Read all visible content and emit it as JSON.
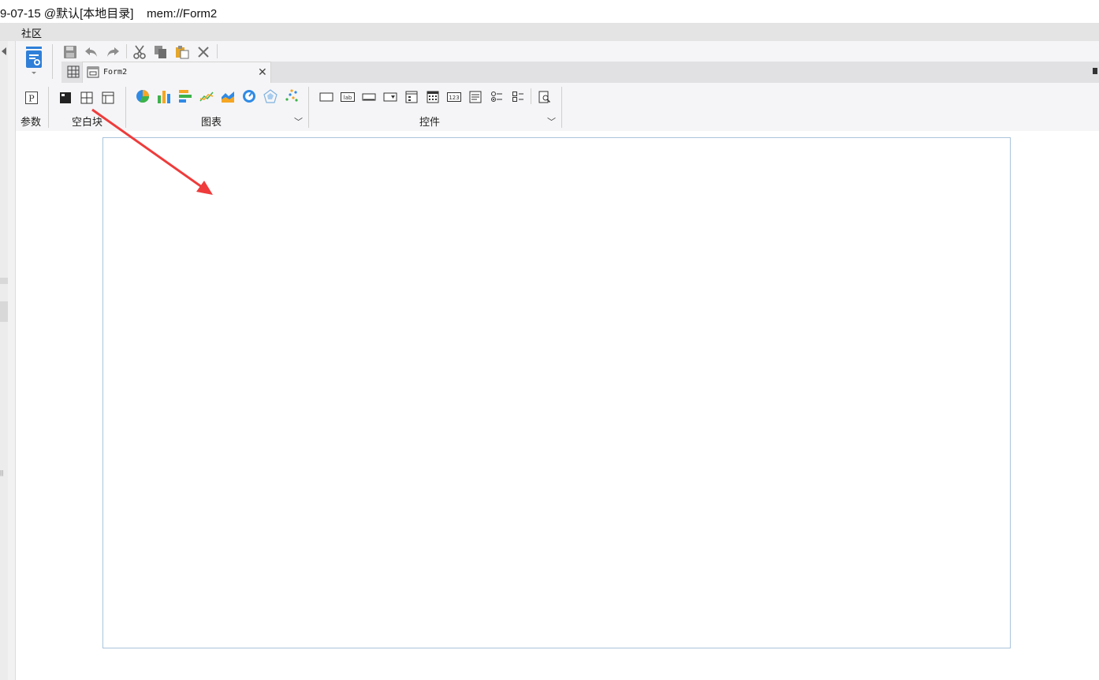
{
  "window": {
    "title": "9-07-15 @默认[本地目录]    mem://Form2"
  },
  "menubar": {
    "items": [
      {
        "label": "社区"
      }
    ]
  },
  "quickbar": {
    "buttons": [
      {
        "name": "save-icon"
      },
      {
        "name": "undo-icon"
      },
      {
        "name": "redo-icon"
      },
      {
        "name": "cut-icon"
      },
      {
        "name": "copy-icon"
      },
      {
        "name": "paste-icon"
      },
      {
        "name": "delete-icon"
      }
    ]
  },
  "tabs": [
    {
      "label": "Form2",
      "active": true
    }
  ],
  "ribbon": {
    "groups": [
      {
        "label": "参数"
      },
      {
        "label": "空白块"
      },
      {
        "label": "图表"
      },
      {
        "label": "控件"
      }
    ],
    "control_icons": {
      "label_text": "lab",
      "number_text": "123"
    }
  },
  "colors": {
    "accent": "#2f7fd8",
    "canvas_border": "#a9c4dc",
    "annotation_arrow": "#ef3b3b",
    "chart_blue": "#2f8ae6",
    "chart_green": "#3db34a",
    "chart_orange": "#f5a623"
  }
}
